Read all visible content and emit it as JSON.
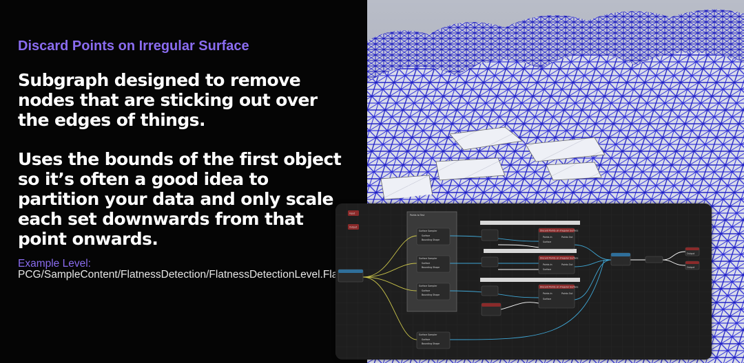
{
  "slide": {
    "kicker": "Discard Points on Irregular Surface",
    "headline_1": "Subgraph designed to remove nodes that are sticking out over the edges of things.",
    "headline_2": "Uses the bounds of the first object so it’s often a good idea to partition your data and only scale each set downwards from that point onwards.",
    "example_label": "Example Level:",
    "example_path": "PCG/SampleContent/FlatnessDetection/FlatnessDetectionLevel.FlatnessDetectionLevel'"
  },
  "graph": {
    "inputs": [
      "Input",
      "Output"
    ],
    "comment_title": "Points to Test",
    "sampler_node": "Surface Sampler",
    "sampler_pins": [
      "Surface",
      "Bounding Shape"
    ],
    "discard_node": "Discard Points on Irregular Surface",
    "discard_pins": [
      "Points In",
      "Surface"
    ],
    "discard_out": "Points Out",
    "outputs": [
      "Output",
      "Output"
    ],
    "colors": {
      "red_header": "#8a2a2a",
      "cyan_wire": "#3fa7d6",
      "yellow_wire": "#c9c34a",
      "graph_bg": "#1e1e1e"
    }
  }
}
